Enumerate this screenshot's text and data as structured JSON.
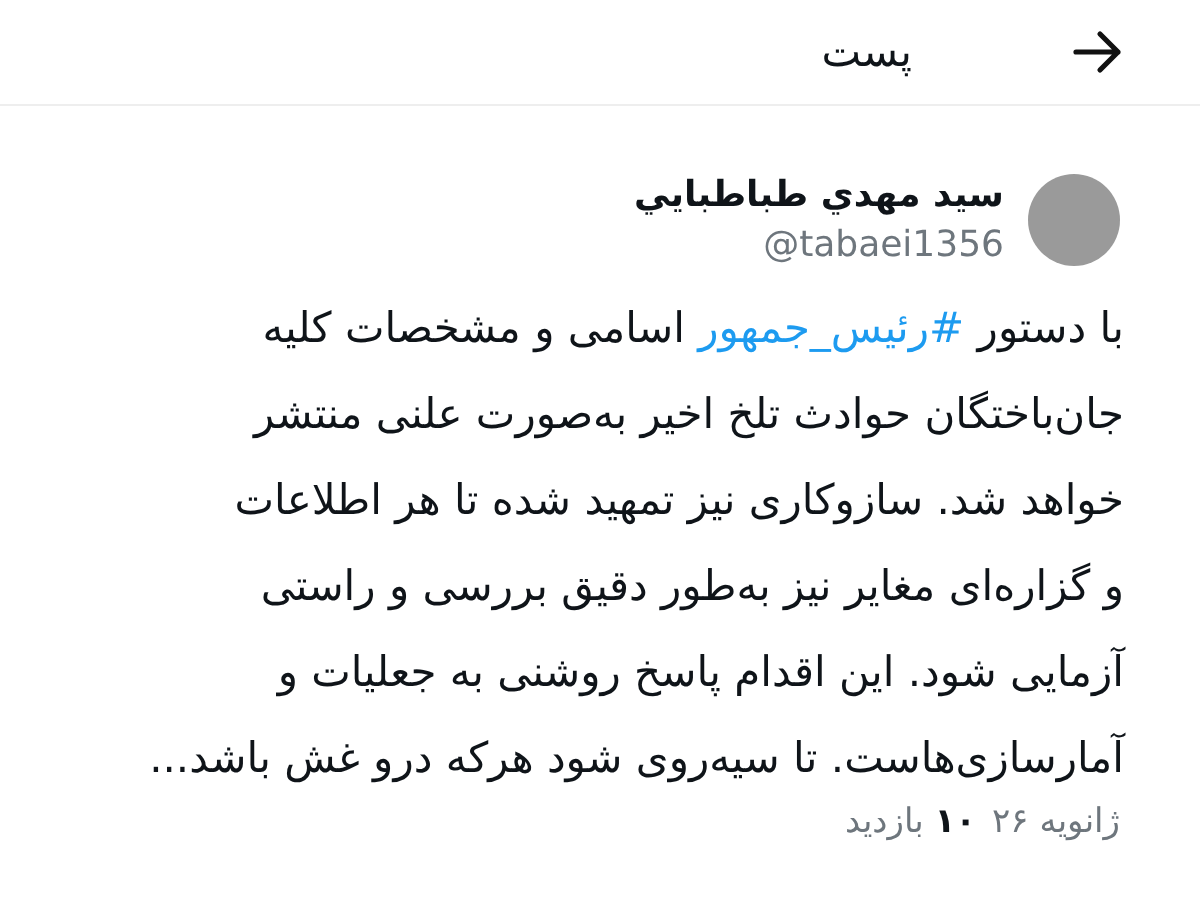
{
  "header": {
    "title": "پست"
  },
  "author": {
    "name": "سيد مهدي طباطبايي",
    "handle": "@tabaei1356"
  },
  "post": {
    "text_before": "با دستور ",
    "hashtag": "#رئیس_جمهور",
    "text_after": " اسامی و مشخصات کلیه\nجان‌باختگان حوادث تلخ اخیر  به‌صورت علنی منتشر\nخواهد شد. سازوکاری نیز تمهید شده تا هر اطلاعات\nو گزاره‌ای مغایر نیز به‌طور دقیق بررسی و راستی\nآزمایی شود. این اقدام پاسخ روشنی به جعلیات و\nآمارسازی‌هاست. تا سیه‌روی شود هرکه درو غش باشد..."
  },
  "meta": {
    "date": "ژانویه ۲۶",
    "views": "**۱۰** بازدید"
  }
}
